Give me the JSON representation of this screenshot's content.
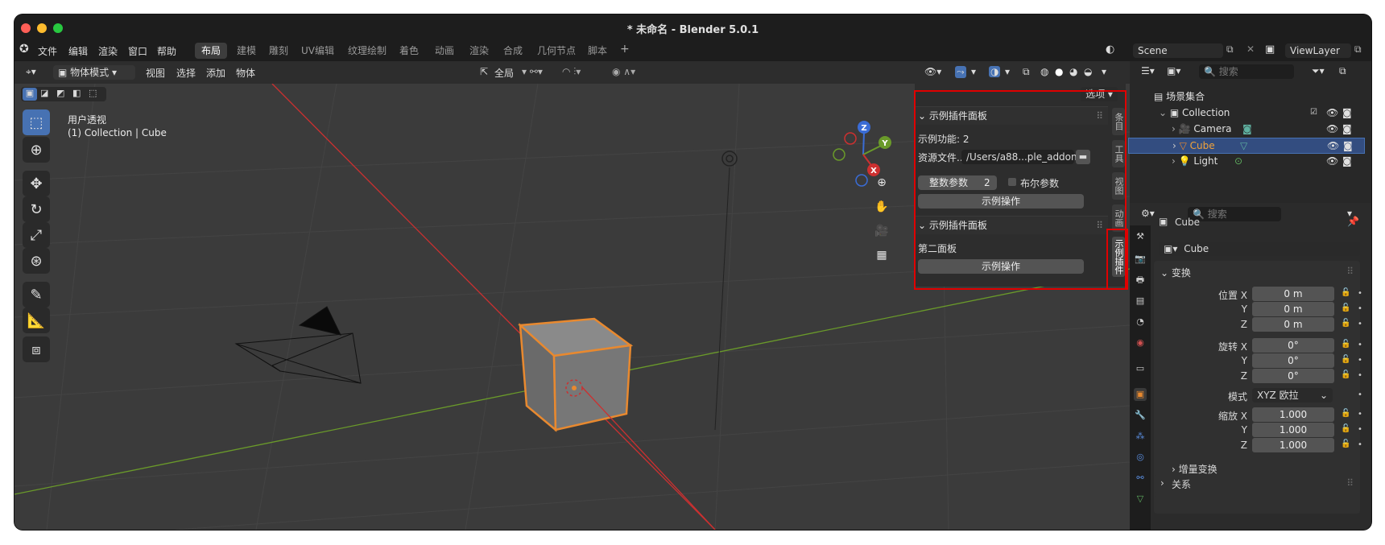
{
  "window": {
    "title": "* 未命名 - Blender 5.0.1"
  },
  "menus": [
    "文件",
    "编辑",
    "渲染",
    "窗口",
    "帮助"
  ],
  "workspaces": [
    "布局",
    "建模",
    "雕刻",
    "UV编辑",
    "纹理绘制",
    "着色",
    "动画",
    "渲染",
    "合成",
    "几何节点",
    "脚本"
  ],
  "scene": {
    "label": "Scene",
    "view_layer": "ViewLayer"
  },
  "viewport_header": {
    "mode": "物体模式",
    "items": [
      "视图",
      "选择",
      "添加",
      "物体"
    ],
    "orientation": "全局"
  },
  "viewport": {
    "perspective": "用户透视",
    "context": "(1) Collection | Cube"
  },
  "npanel": {
    "options": "选项",
    "panel1": {
      "title": "示例插件面板",
      "func": "示例功能: 2",
      "res_label": "资源文件...",
      "res_value": "/Users/a88...ple_addon",
      "int_label": "整数参数",
      "int_value": "2",
      "bool_label": "布尔参数",
      "op": "示例操作"
    },
    "panel2": {
      "title": "示例插件面板",
      "text": "第二面板",
      "op": "示例操作"
    },
    "tabs": [
      "条目",
      "工具",
      "视图",
      "动画",
      "示例插件"
    ]
  },
  "outliner": {
    "search_placeholder": "搜索",
    "rows": [
      "场景集合",
      "Collection",
      "Camera",
      "Cube",
      "Light"
    ]
  },
  "properties": {
    "search_placeholder": "搜索",
    "object_name": "Cube",
    "data_name": "Cube",
    "transform": {
      "title": "变换",
      "location": {
        "label": "位置 X",
        "x": "0 m",
        "y": "0 m",
        "z": "0 m"
      },
      "rotation": {
        "label": "旋转 X",
        "x": "0°",
        "y": "0°",
        "z": "0°"
      },
      "mode_label": "模式",
      "mode_value": "XYZ 欧拉",
      "scale": {
        "label": "缩放 X",
        "x": "1.000",
        "y": "1.000",
        "z": "1.000"
      },
      "axis_y": "Y",
      "axis_z": "Z"
    },
    "delta": "增量变换",
    "relations": "关系"
  },
  "gizmo": {
    "x": "X",
    "y": "Y",
    "z": "Z"
  },
  "colors": {
    "accent": "#4772b3",
    "selected_outline": "#e8892f",
    "highlight": "#e00000",
    "x_axis": "#cc3030",
    "y_axis": "#6a9a2a"
  }
}
